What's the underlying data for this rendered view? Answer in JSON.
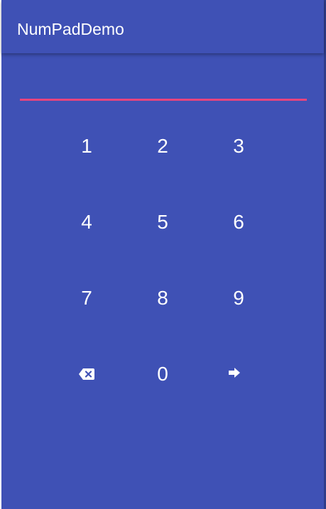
{
  "app_bar": {
    "title": "NumPadDemo"
  },
  "input": {
    "value": "",
    "underline_color": "#e8457e"
  },
  "colors": {
    "background": "#3f51b5",
    "text": "#ffffff"
  },
  "keypad": {
    "keys": [
      "1",
      "2",
      "3",
      "4",
      "5",
      "6",
      "7",
      "8",
      "9",
      "0"
    ],
    "backspace_icon": "backspace-icon",
    "done_icon": "arrow-right-icon"
  }
}
